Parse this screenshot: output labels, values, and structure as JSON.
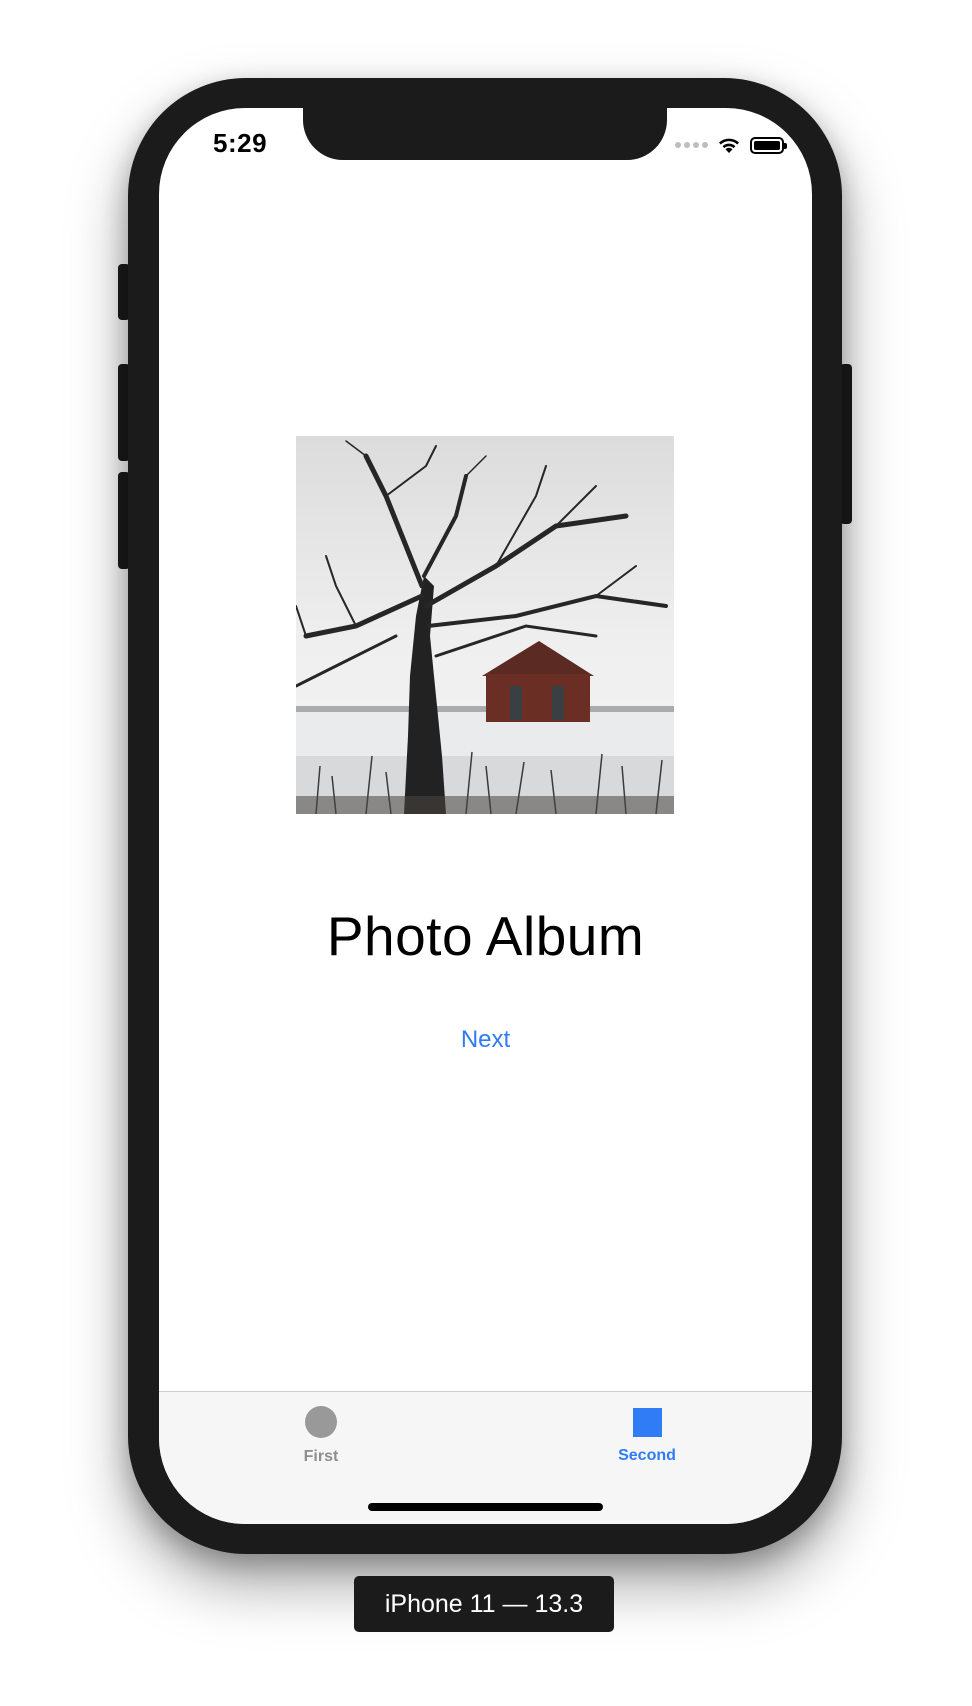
{
  "status_bar": {
    "time": "5:29",
    "icons": [
      "signal-dots-icon",
      "wifi-icon",
      "battery-icon"
    ]
  },
  "main": {
    "image_description": "photo-leafless-tree-and-brick-house-in-snow",
    "title": "Photo Album",
    "next_label": "Next"
  },
  "tab_bar": {
    "tabs": [
      {
        "label": "First",
        "icon": "circle-icon",
        "selected": false
      },
      {
        "label": "Second",
        "icon": "square-icon",
        "selected": true
      }
    ]
  },
  "device_label": "iPhone 11 — 13.3",
  "colors": {
    "accent": "#2f7cf6",
    "inactive_tab": "#8e8e8e",
    "device_frame": "#1b1b1b"
  }
}
